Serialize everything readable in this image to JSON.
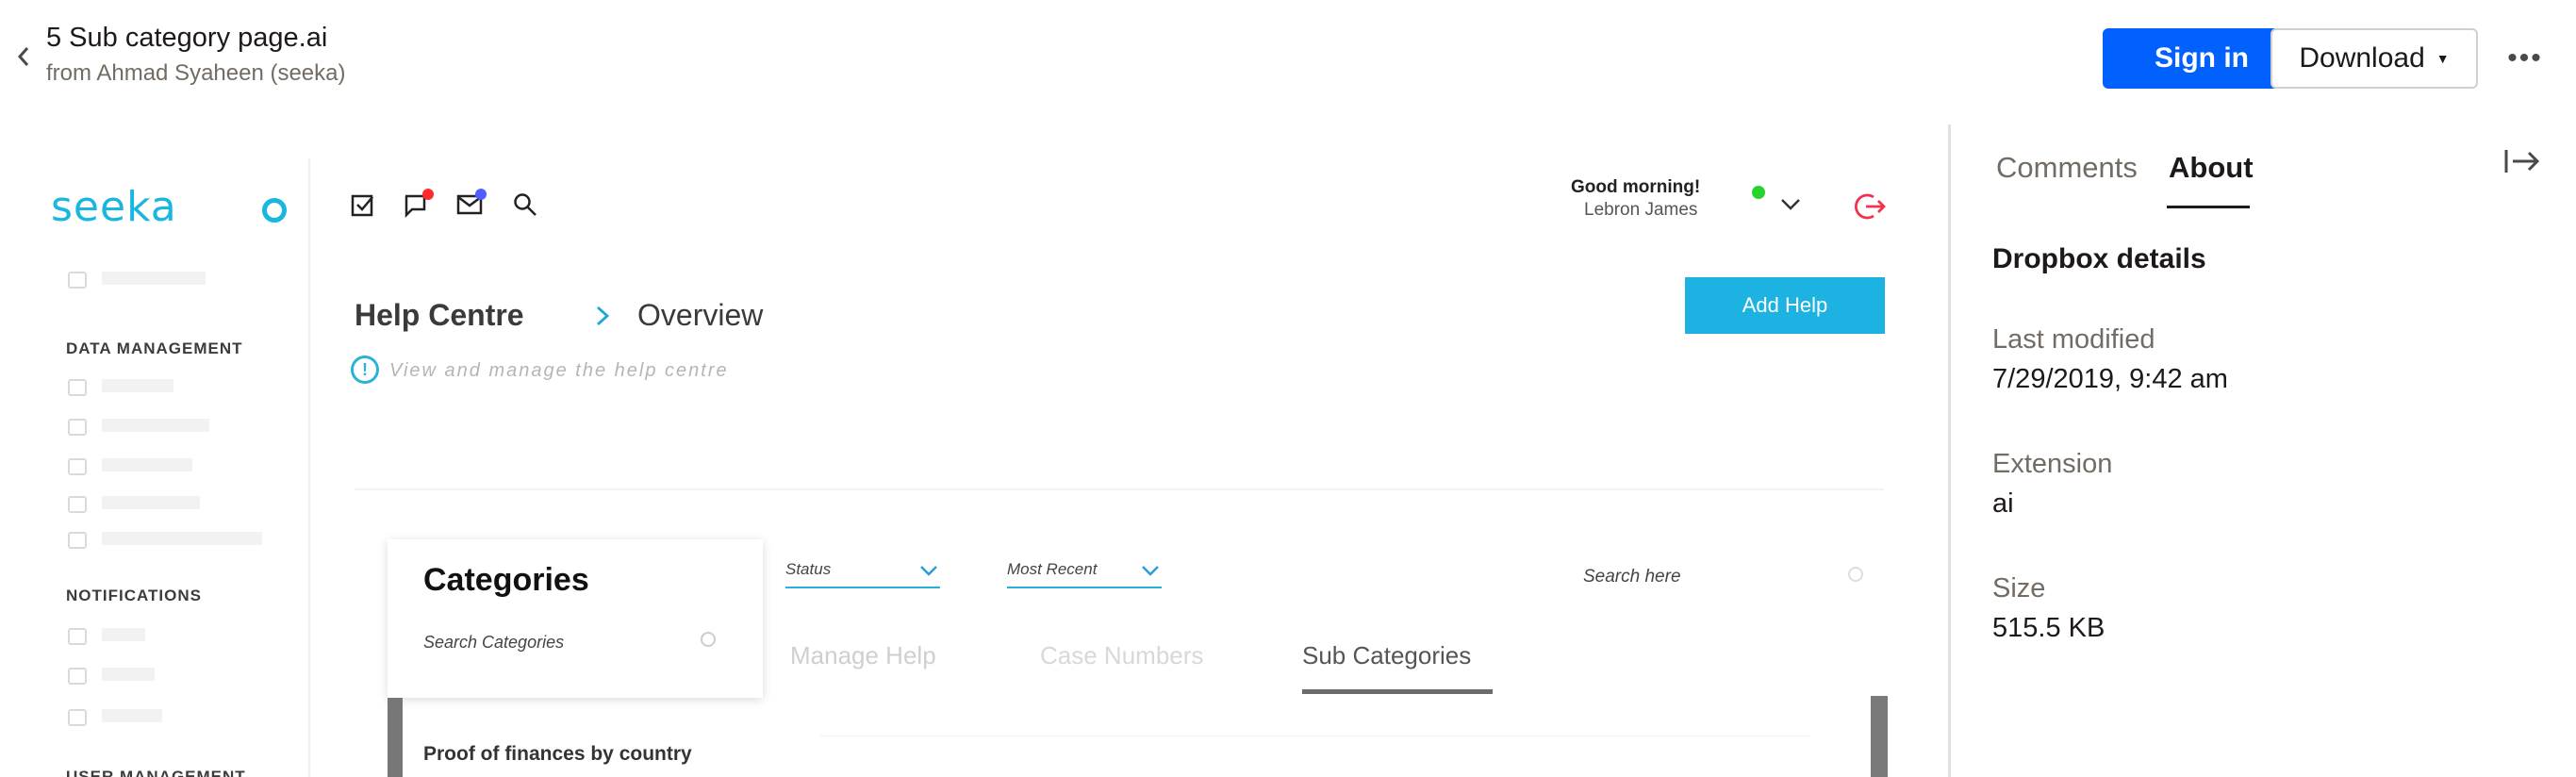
{
  "header": {
    "file_name": "5 Sub category page.ai",
    "owner": "from Ahmad Syaheen (seeka)",
    "sign_in_label": "Sign in",
    "download_label": "Download",
    "more_label": "•••"
  },
  "design": {
    "logo": "seeka",
    "sections": {
      "data_management": "DATA MANAGEMENT",
      "notifications": "NOTIFICATIONS",
      "user_management": "USER MANAGEMENT"
    },
    "greeting": "Good morning!",
    "user_name": "Lebron James",
    "breadcrumb_root": "Help Centre",
    "breadcrumb_current": "Overview",
    "add_help_label": "Add Help",
    "subtitle": "View and manage the help centre",
    "categories_title": "Categories",
    "search_categories_placeholder": "Search Categories",
    "filter_status": "Status",
    "filter_recent": "Most Recent",
    "search_here_placeholder": "Search here",
    "tabs": [
      "Manage Help",
      "Case Numbers",
      "Sub Categories"
    ],
    "active_tab": "Sub Categories",
    "first_row": "Proof of finances by country"
  },
  "panel": {
    "tabs": [
      "Comments",
      "About"
    ],
    "active_tab": "About",
    "heading": "Dropbox details",
    "details": [
      {
        "label": "Last modified",
        "value": "7/29/2019, 9:42 am"
      },
      {
        "label": "Extension",
        "value": "ai"
      },
      {
        "label": "Size",
        "value": "515.5 KB"
      }
    ]
  },
  "colors": {
    "primary_button": "#0061fe",
    "design_accent": "#19b6e0",
    "logout": "#f0334c",
    "online": "#28d42c"
  }
}
